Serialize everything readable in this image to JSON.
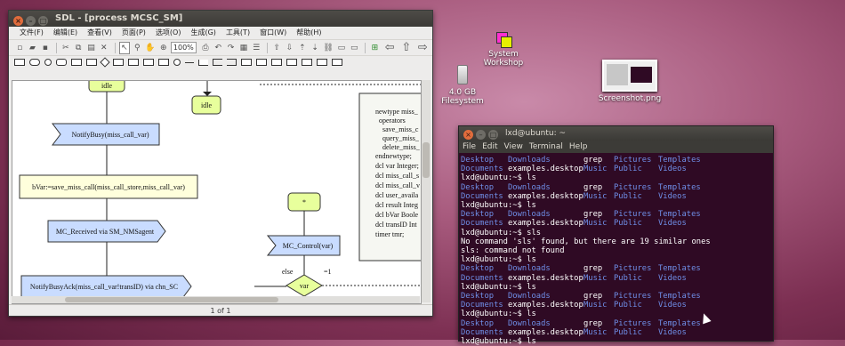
{
  "desktop": {
    "icons": [
      {
        "label": "System Workshop"
      },
      {
        "label": "4.0 GB Filesystem"
      },
      {
        "label": "Screenshot.png"
      }
    ]
  },
  "sdl": {
    "title": "SDL - [process MCSC_SM]",
    "menu": [
      "文件(F)",
      "编辑(E)",
      "查看(V)",
      "页面(P)",
      "选项(O)",
      "生成(G)",
      "工具(T)",
      "窗口(W)",
      "帮助(H)"
    ],
    "zoom": "100%",
    "status": "1 of 1",
    "diagram": {
      "idle1": "idle",
      "idle2": "idle",
      "notify": "NotifyBusy(miss_call_var)",
      "bvar": "bVar:=save_miss_call(miss_call_store,miss_call_var)",
      "mc_received": "MC_Received via SM_NMSagent",
      "notify_ack": "NotifyBusyAck(miss_call_var!transID) via chn_SC",
      "star": "*",
      "mc_control": "MC_Control(var)",
      "var": "var",
      "else": "else",
      "eq1": "=1",
      "decl": [
        "newtype miss_",
        "operators",
        "save_miss_c",
        "query_miss_",
        "delete_miss_",
        "endnewtype;",
        "dcl var Integer;",
        "dcl miss_call_s",
        "dcl miss_call_v",
        "dcl user_availa",
        "dcl result Integ",
        "dcl bVar Boole",
        "dcl transID Int",
        "timer tmr;"
      ]
    }
  },
  "terminal": {
    "title": "lxd@ubuntu: ~",
    "menu": [
      "File",
      "Edit",
      "View",
      "Terminal",
      "Help"
    ],
    "lines": [
      {
        "type": "ls",
        "cols": [
          "Desktop",
          "Downloads",
          "grep",
          "Pictures",
          "Templates"
        ]
      },
      {
        "type": "ls2",
        "cols": [
          "Documents",
          "examples.desktop",
          "Music",
          "Public",
          "Videos"
        ]
      },
      {
        "type": "text",
        "text": "lxd@ubuntu:~$ ls"
      },
      {
        "type": "ls",
        "cols": [
          "Desktop",
          "Downloads",
          "grep",
          "Pictures",
          "Templates"
        ]
      },
      {
        "type": "ls2",
        "cols": [
          "Documents",
          "examples.desktop",
          "Music",
          "Public",
          "Videos"
        ]
      },
      {
        "type": "text",
        "text": "lxd@ubuntu:~$ ls"
      },
      {
        "type": "ls",
        "cols": [
          "Desktop",
          "Downloads",
          "grep",
          "Pictures",
          "Templates"
        ]
      },
      {
        "type": "ls2",
        "cols": [
          "Documents",
          "examples.desktop",
          "Music",
          "Public",
          "Videos"
        ]
      },
      {
        "type": "text",
        "text": "lxd@ubuntu:~$ sls"
      },
      {
        "type": "text",
        "text": "No command 'sls' found, but there are 19 similar ones"
      },
      {
        "type": "text",
        "text": "sls: command not found"
      },
      {
        "type": "text",
        "text": "lxd@ubuntu:~$ ls"
      },
      {
        "type": "ls",
        "cols": [
          "Desktop",
          "Downloads",
          "grep",
          "Pictures",
          "Templates"
        ]
      },
      {
        "type": "ls2",
        "cols": [
          "Documents",
          "examples.desktop",
          "Music",
          "Public",
          "Videos"
        ]
      },
      {
        "type": "text",
        "text": "lxd@ubuntu:~$ ls"
      },
      {
        "type": "ls",
        "cols": [
          "Desktop",
          "Downloads",
          "grep",
          "Pictures",
          "Templates"
        ]
      },
      {
        "type": "ls2",
        "cols": [
          "Documents",
          "examples.desktop",
          "Music",
          "Public",
          "Videos"
        ]
      },
      {
        "type": "text",
        "text": "lxd@ubuntu:~$ ls"
      },
      {
        "type": "ls",
        "cols": [
          "Desktop",
          "Downloads",
          "grep",
          "Pictures",
          "Templates"
        ]
      },
      {
        "type": "ls2",
        "cols": [
          "Documents",
          "examples.desktop",
          "Music",
          "Public",
          "Videos"
        ]
      },
      {
        "type": "text",
        "text": "lxd@ubuntu:~$ ls"
      }
    ]
  },
  "colors": {
    "dir": "#6f8fe8",
    "terminal_bg": "#2f0a24",
    "diagram_fill": "#e8ff9c",
    "diagram_blue": "#c9dcff"
  }
}
